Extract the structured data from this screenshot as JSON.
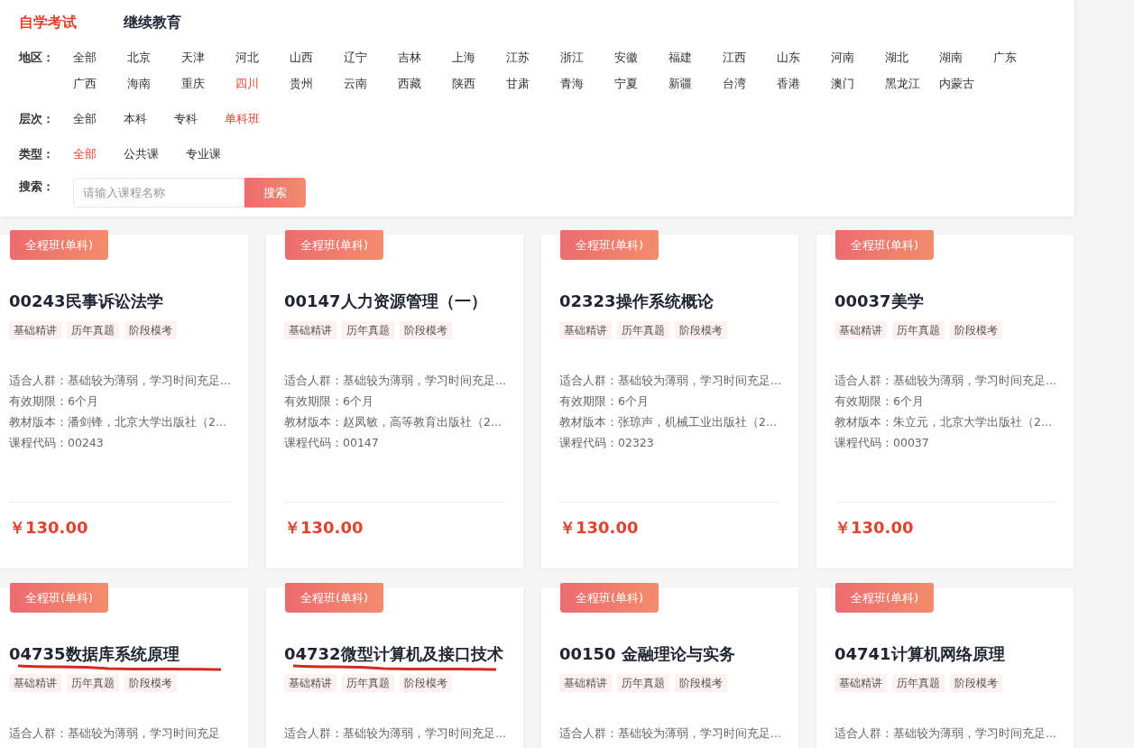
{
  "top_tabs": [
    {
      "label": "自学考试",
      "selected": true
    },
    {
      "label": "继续教育",
      "selected": false
    }
  ],
  "filters": [
    {
      "label": "地区：",
      "options": [
        {
          "label": "全部",
          "selected": false
        },
        {
          "label": "北京",
          "selected": false
        },
        {
          "label": "天津",
          "selected": false
        },
        {
          "label": "河北",
          "selected": false
        },
        {
          "label": "山西",
          "selected": false
        },
        {
          "label": "辽宁",
          "selected": false
        },
        {
          "label": "吉林",
          "selected": false
        },
        {
          "label": "上海",
          "selected": false
        },
        {
          "label": "江苏",
          "selected": false
        },
        {
          "label": "浙江",
          "selected": false
        },
        {
          "label": "安徽",
          "selected": false
        },
        {
          "label": "福建",
          "selected": false
        },
        {
          "label": "江西",
          "selected": false
        },
        {
          "label": "山东",
          "selected": false
        },
        {
          "label": "河南",
          "selected": false
        },
        {
          "label": "湖北",
          "selected": false
        },
        {
          "label": "湖南",
          "selected": false
        },
        {
          "label": "广东",
          "selected": false
        },
        {
          "label": "广西",
          "selected": false
        },
        {
          "label": "海南",
          "selected": false
        },
        {
          "label": "重庆",
          "selected": false
        },
        {
          "label": "四川",
          "selected": true
        },
        {
          "label": "贵州",
          "selected": false
        },
        {
          "label": "云南",
          "selected": false
        },
        {
          "label": "西藏",
          "selected": false
        },
        {
          "label": "陕西",
          "selected": false
        },
        {
          "label": "甘肃",
          "selected": false
        },
        {
          "label": "青海",
          "selected": false
        },
        {
          "label": "宁夏",
          "selected": false
        },
        {
          "label": "新疆",
          "selected": false
        },
        {
          "label": "台湾",
          "selected": false
        },
        {
          "label": "香港",
          "selected": false
        },
        {
          "label": "澳门",
          "selected": false
        },
        {
          "label": "黑龙江",
          "selected": false
        },
        {
          "label": "内蒙古",
          "selected": false
        }
      ]
    },
    {
      "label": "层次：",
      "options": [
        {
          "label": "全部",
          "selected": false
        },
        {
          "label": "本科",
          "selected": false
        },
        {
          "label": "专科",
          "selected": false
        },
        {
          "label": "单科班",
          "selected": true
        }
      ]
    },
    {
      "label": "类型：",
      "options": [
        {
          "label": "全部",
          "selected": true
        },
        {
          "label": "公共课",
          "selected": false
        },
        {
          "label": "专业课",
          "selected": false
        }
      ]
    }
  ],
  "search": {
    "label": "搜索：",
    "placeholder": "请输入课程名称",
    "button": "搜索"
  },
  "courses": [
    {
      "badge": "全程班(单科)",
      "title": "00243民事诉讼法学",
      "underlined": false,
      "tags": [
        "基础精讲",
        "历年真题",
        "阶段模考"
      ],
      "info": [
        "适合人群：基础较为薄弱，学习时间充足...",
        "有效期限：6个月",
        "教材版本：潘剑锋，北京大学出版社（2...",
        "课程代码：00243"
      ],
      "price": "￥130.00"
    },
    {
      "badge": "全程班(单科)",
      "title": "00147人力资源管理（一）",
      "underlined": false,
      "tags": [
        "基础精讲",
        "历年真题",
        "阶段模考"
      ],
      "info": [
        "适合人群：基础较为薄弱，学习时间充足...",
        "有效期限：6个月",
        "教材版本：赵凤敏，高等教育出版社（2...",
        "课程代码：00147"
      ],
      "price": "￥130.00"
    },
    {
      "badge": "全程班(单科)",
      "title": "02323操作系统概论",
      "underlined": false,
      "tags": [
        "基础精讲",
        "历年真题",
        "阶段模考"
      ],
      "info": [
        "适合人群：基础较为薄弱，学习时间充足...",
        "有效期限：6个月",
        "教材版本：张琼声，机械工业出版社（2...",
        "课程代码：02323"
      ],
      "price": "￥130.00"
    },
    {
      "badge": "全程班(单科)",
      "title": "00037美学",
      "underlined": false,
      "tags": [
        "基础精讲",
        "历年真题",
        "阶段模考"
      ],
      "info": [
        "适合人群：基础较为薄弱，学习时间充足...",
        "有效期限：6个月",
        "教材版本：朱立元，北京大学出版社（2...",
        "课程代码：00037"
      ],
      "price": "￥130.00"
    },
    {
      "badge": "全程班(单科)",
      "title": "04735数据库系统原理",
      "underlined": true,
      "tags": [
        "基础精讲",
        "历年真题",
        "阶段模考"
      ],
      "info": [
        "适合人群：基础较为薄弱，学习时间充足"
      ]
    },
    {
      "badge": "全程班(单科)",
      "title": "04732微型计算机及接口技术",
      "underlined": true,
      "tags": [
        "基础精讲",
        "历年真题",
        "阶段模考"
      ],
      "info": [
        "适合人群：基础较为薄弱，学习时间充足..."
      ]
    },
    {
      "badge": "全程班(单科)",
      "title": "00150 金融理论与实务",
      "underlined": false,
      "tags": [
        "基础精讲",
        "历年真题",
        "阶段模考"
      ],
      "info": [
        "适合人群：基础较为薄弱，学习时间充足..."
      ]
    },
    {
      "badge": "全程班(单科)",
      "title": "04741计算机网络原理",
      "underlined": false,
      "tags": [
        "基础精讲",
        "历年真题",
        "阶段模考"
      ],
      "info": [
        "适合人群：基础较为薄弱，学习时间充足..."
      ]
    }
  ]
}
